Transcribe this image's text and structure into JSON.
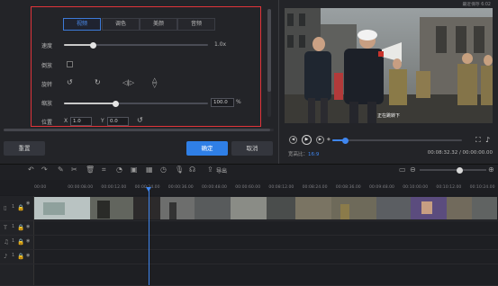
{
  "window_title": "最近保存 6:02",
  "properties": {
    "tabs": [
      "视频",
      "调色",
      "美颜",
      "音频"
    ],
    "speed": {
      "label": "速度",
      "value_text": "1.0x",
      "fraction": 0.2
    },
    "reverse": {
      "label": "倒放",
      "checked": false
    },
    "rotate": {
      "label": "旋转"
    },
    "scale": {
      "label": "缩放",
      "value": "100.0",
      "unit": "%",
      "fraction": 0.36
    },
    "position": {
      "label": "位置",
      "x_label": "X",
      "x_value": "1.0",
      "y_label": "Y",
      "y_value": "0.0"
    }
  },
  "buttons": {
    "reset": "重置",
    "ok": "确定",
    "cancel": "取消"
  },
  "preview": {
    "subtitle": "正在跳转下",
    "progress_fraction": 0.1,
    "time_display": "00:08:32.32 / 00:00:00.00",
    "aspect_label": "宽高比：",
    "aspect_value": "16:9"
  },
  "toolbar": {
    "export_label": "导出",
    "zoom_fraction": 0.6
  },
  "ruler": {
    "labels": [
      "00:00",
      "00:00:08.00",
      "00:00:12.00",
      "00:00:24.00",
      "00:00:36.00",
      "00:00:48.00",
      "00:00:60.00",
      "00:08:12.00",
      "00:08:24.00",
      "00:08:36.00",
      "00:09:48.00",
      "00:10:00.00",
      "00:10:12.00",
      "00:10:24.00"
    ]
  },
  "tracks": {
    "video_index": "1",
    "audio_index": "1"
  },
  "colors": {
    "accent": "#2f7fe6",
    "highlight_border": "#e0343a",
    "playhead": "#3f86ef"
  }
}
